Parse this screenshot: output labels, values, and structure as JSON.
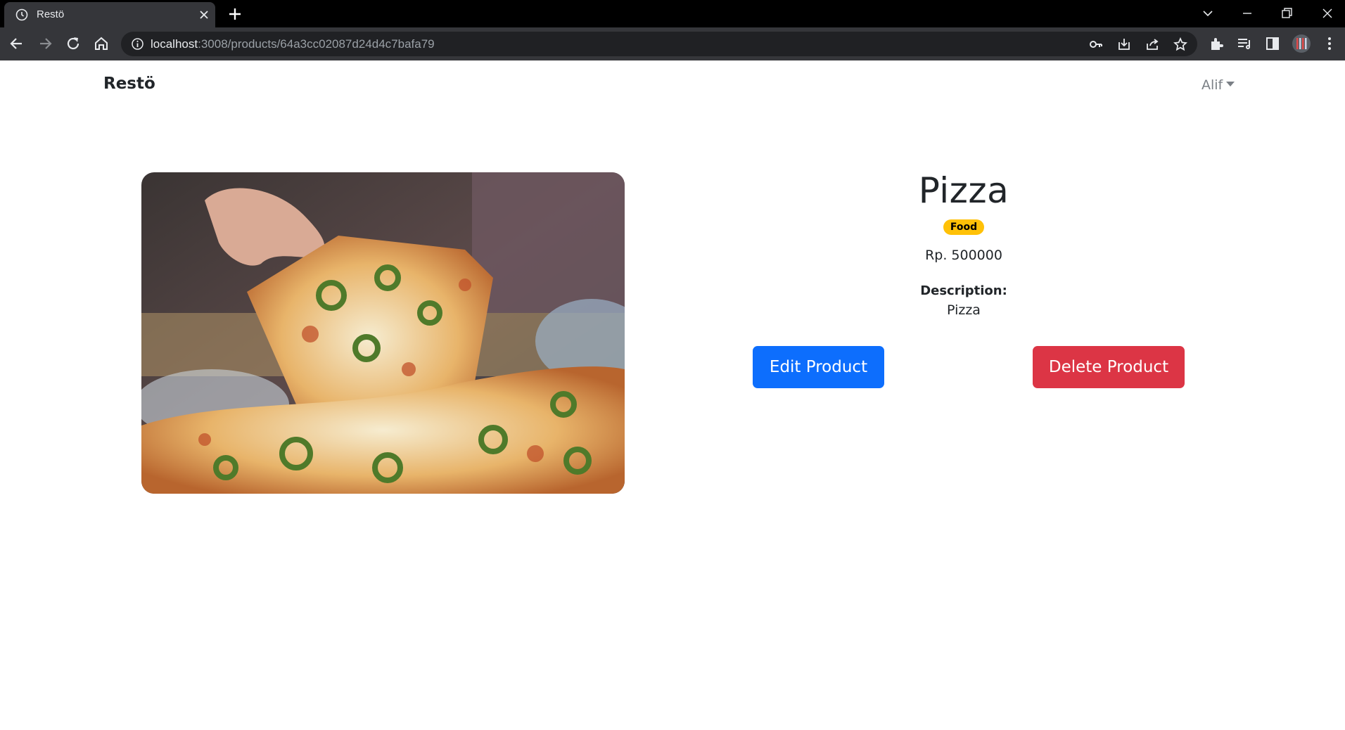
{
  "browser": {
    "tab_title": "Restö",
    "url_host": "localhost",
    "url_path": ":3008/products/64a3cc02087d24d4c7bafa79",
    "icons": [
      "clock-favicon-icon",
      "close-icon",
      "new-tab-icon",
      "chevron-down-icon",
      "minimize-icon",
      "restore-icon",
      "close-window-icon",
      "back-icon",
      "forward-icon",
      "reload-icon",
      "home-icon",
      "info-icon",
      "key-icon",
      "install-icon",
      "share-icon",
      "star-icon",
      "extensions-icon",
      "reading-list-icon",
      "side-panel-icon",
      "profile-icon",
      "menu-icon"
    ]
  },
  "navbar": {
    "brand": "Restö",
    "user": "Alif"
  },
  "product": {
    "name": "Pizza",
    "category": "Food",
    "price": "Rp. 500000",
    "description_label": "Description:",
    "description": "Pizza",
    "image_alt": "pizza-photo"
  },
  "actions": {
    "edit_label": "Edit Product",
    "delete_label": "Delete Product"
  },
  "colors": {
    "primary": "#0d6efd",
    "danger": "#dc3545",
    "warning": "#ffc107",
    "text": "#212529"
  }
}
